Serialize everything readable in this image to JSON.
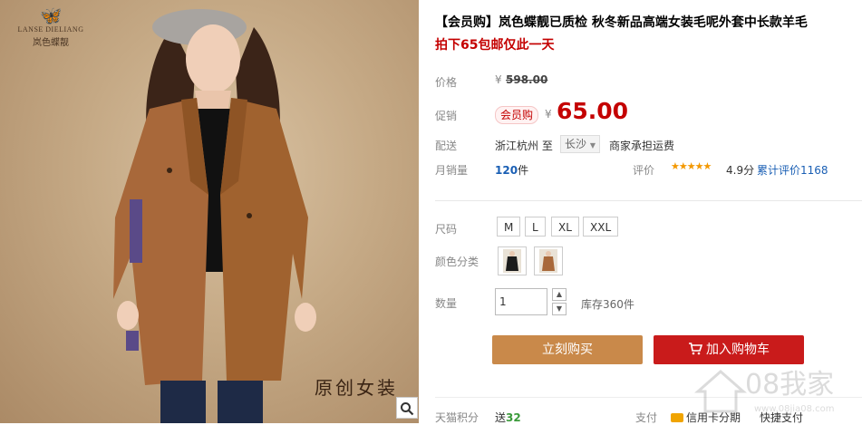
{
  "image": {
    "brand_en": "LANSE DIELIANG",
    "brand_cn": "岚色蝶靓",
    "slogan": "原创女装",
    "zoom_icon": "magnifier-icon"
  },
  "product": {
    "title": "【会员购】岚色蝶靓已质检 秋冬新品高端女装毛呢外套中长款羊毛",
    "subtitle": "拍下65包邮仅此一天"
  },
  "price": {
    "label": "价格",
    "currency": "¥",
    "original": "598.00",
    "promo_label": "促销",
    "badge": "会员购",
    "promo_currency": "¥",
    "promo": "65.00"
  },
  "shipping": {
    "label": "配送",
    "from": "浙江杭州 至",
    "to": "长沙",
    "note": "商家承担运费"
  },
  "sales": {
    "label": "月销量",
    "count": "120",
    "unit": "件",
    "rating_label": "评价",
    "stars": "★★★★★",
    "score": "4.9分",
    "reviews": "累计评价1168"
  },
  "options": {
    "size_label": "尺码",
    "sizes": [
      "M",
      "L",
      "XL",
      "XXL"
    ],
    "color_label": "颜色分类",
    "colors": [
      "black-coat",
      "camel-coat"
    ]
  },
  "quantity": {
    "label": "数量",
    "value": "1",
    "stock": "库存360件"
  },
  "actions": {
    "buy": "立刻购买",
    "cart": "加入购物车"
  },
  "footer": {
    "points_label": "天猫积分",
    "points_prefix": "送",
    "points": "32",
    "pay_label": "支付",
    "pay_option1": "信用卡分期",
    "pay_option2": "快捷支付"
  },
  "watermark": {
    "text": "08我家",
    "url": "www.08jia08.com"
  },
  "colors": {
    "price_red": "#c40000",
    "buy_button": "#c9894a",
    "cart_button": "#c91b1b",
    "link_blue": "#1a5fb4"
  }
}
